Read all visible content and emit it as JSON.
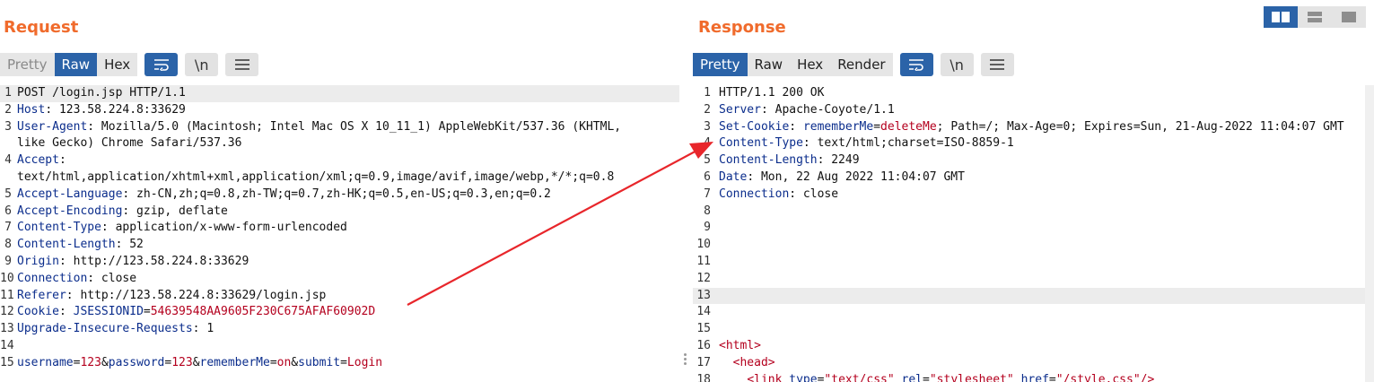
{
  "request": {
    "title": "Request",
    "view_tabs": [
      "Pretty",
      "Raw",
      "Hex"
    ],
    "active_tab": "Raw",
    "icons": [
      "wrap-lines-icon",
      "newline-toggle-icon",
      "menu-icon"
    ],
    "newline_label": "\\n",
    "lines": [
      {
        "n": "1",
        "parts": [
          {
            "t": "POST /login.jsp HTTP/1.1",
            "c": ""
          }
        ]
      },
      {
        "n": "2",
        "parts": [
          {
            "t": "Host",
            "c": "k"
          },
          {
            "t": ": 123.58.224.8:33629",
            "c": ""
          }
        ]
      },
      {
        "n": "3",
        "parts": [
          {
            "t": "User-Agent",
            "c": "k"
          },
          {
            "t": ": Mozilla/5.0 (Macintosh; Intel Mac OS X 10_11_1) AppleWebKit/537.36 (KHTML,",
            "c": ""
          }
        ]
      },
      {
        "n": "",
        "parts": [
          {
            "t": "like Gecko) Chrome Safari/537.36",
            "c": ""
          }
        ]
      },
      {
        "n": "4",
        "parts": [
          {
            "t": "Accept",
            "c": "k"
          },
          {
            "t": ":",
            "c": ""
          }
        ]
      },
      {
        "n": "",
        "parts": [
          {
            "t": "text/html,application/xhtml+xml,application/xml;q=0.9,image/avif,image/webp,*/*;q=0.8",
            "c": ""
          }
        ]
      },
      {
        "n": "5",
        "parts": [
          {
            "t": "Accept-Language",
            "c": "k"
          },
          {
            "t": ": zh-CN,zh;q=0.8,zh-TW;q=0.7,zh-HK;q=0.5,en-US;q=0.3,en;q=0.2",
            "c": ""
          }
        ]
      },
      {
        "n": "6",
        "parts": [
          {
            "t": "Accept-Encoding",
            "c": "k"
          },
          {
            "t": ": gzip, deflate",
            "c": ""
          }
        ]
      },
      {
        "n": "7",
        "parts": [
          {
            "t": "Content-Type",
            "c": "k"
          },
          {
            "t": ": application/x-www-form-urlencoded",
            "c": ""
          }
        ]
      },
      {
        "n": "8",
        "parts": [
          {
            "t": "Content-Length",
            "c": "k"
          },
          {
            "t": ": 52",
            "c": ""
          }
        ]
      },
      {
        "n": "9",
        "parts": [
          {
            "t": "Origin",
            "c": "k"
          },
          {
            "t": ": http://123.58.224.8:33629",
            "c": ""
          }
        ]
      },
      {
        "n": "10",
        "parts": [
          {
            "t": "Connection",
            "c": "k"
          },
          {
            "t": ": close",
            "c": ""
          }
        ]
      },
      {
        "n": "11",
        "parts": [
          {
            "t": "Referer",
            "c": "k"
          },
          {
            "t": ": http://123.58.224.8:33629/login.jsp",
            "c": ""
          }
        ]
      },
      {
        "n": "12",
        "parts": [
          {
            "t": "Cookie",
            "c": "k"
          },
          {
            "t": ": ",
            "c": ""
          },
          {
            "t": "JSESSIONID",
            "c": "k"
          },
          {
            "t": "=",
            "c": ""
          },
          {
            "t": "54639548AA9605F230C675AFAF60902D",
            "c": "v"
          }
        ]
      },
      {
        "n": "13",
        "parts": [
          {
            "t": "Upgrade-Insecure-Requests",
            "c": "k"
          },
          {
            "t": ": 1",
            "c": ""
          }
        ]
      },
      {
        "n": "14",
        "parts": [
          {
            "t": "",
            "c": ""
          }
        ]
      },
      {
        "n": "15",
        "parts": [
          {
            "t": "username",
            "c": "k"
          },
          {
            "t": "=",
            "c": ""
          },
          {
            "t": "123",
            "c": "v"
          },
          {
            "t": "&",
            "c": ""
          },
          {
            "t": "password",
            "c": "k"
          },
          {
            "t": "=",
            "c": ""
          },
          {
            "t": "123",
            "c": "v"
          },
          {
            "t": "&",
            "c": ""
          },
          {
            "t": "rememberMe",
            "c": "k"
          },
          {
            "t": "=",
            "c": ""
          },
          {
            "t": "on",
            "c": "v"
          },
          {
            "t": "&",
            "c": ""
          },
          {
            "t": "submit",
            "c": "k"
          },
          {
            "t": "=",
            "c": ""
          },
          {
            "t": "Login",
            "c": "v"
          }
        ]
      }
    ]
  },
  "response": {
    "title": "Response",
    "view_tabs": [
      "Pretty",
      "Raw",
      "Hex",
      "Render"
    ],
    "active_tab": "Pretty",
    "icons": [
      "wrap-lines-icon",
      "newline-toggle-icon",
      "menu-icon"
    ],
    "newline_label": "\\n",
    "lines": [
      {
        "n": "1",
        "parts": [
          {
            "t": "HTTP/1.1 200 OK",
            "c": ""
          }
        ]
      },
      {
        "n": "2",
        "parts": [
          {
            "t": "Server",
            "c": "k"
          },
          {
            "t": ": Apache-Coyote/1.1",
            "c": ""
          }
        ]
      },
      {
        "n": "3",
        "parts": [
          {
            "t": "Set-Cookie",
            "c": "k"
          },
          {
            "t": ": ",
            "c": ""
          },
          {
            "t": "rememberMe",
            "c": "k"
          },
          {
            "t": "=",
            "c": ""
          },
          {
            "t": "deleteMe",
            "c": "v"
          },
          {
            "t": "; Path=/; Max-Age=0; Expires=Sun, 21-Aug-2022 11:04:07 GMT",
            "c": ""
          }
        ]
      },
      {
        "n": "4",
        "parts": [
          {
            "t": "Content-Type",
            "c": "k"
          },
          {
            "t": ": text/html;charset=ISO-8859-1",
            "c": ""
          }
        ]
      },
      {
        "n": "5",
        "parts": [
          {
            "t": "Content-Length",
            "c": "k"
          },
          {
            "t": ": 2249",
            "c": ""
          }
        ]
      },
      {
        "n": "6",
        "parts": [
          {
            "t": "Date",
            "c": "k"
          },
          {
            "t": ": Mon, 22 Aug 2022 11:04:07 GMT",
            "c": ""
          }
        ]
      },
      {
        "n": "7",
        "parts": [
          {
            "t": "Connection",
            "c": "k"
          },
          {
            "t": ": close",
            "c": ""
          }
        ]
      },
      {
        "n": "8",
        "parts": [
          {
            "t": "",
            "c": ""
          }
        ]
      },
      {
        "n": "9",
        "parts": [
          {
            "t": "",
            "c": ""
          }
        ]
      },
      {
        "n": "10",
        "parts": [
          {
            "t": "",
            "c": ""
          }
        ]
      },
      {
        "n": "11",
        "parts": [
          {
            "t": "",
            "c": ""
          }
        ]
      },
      {
        "n": "12",
        "parts": [
          {
            "t": "",
            "c": ""
          }
        ]
      },
      {
        "n": "13",
        "parts": [
          {
            "t": "",
            "c": ""
          }
        ]
      },
      {
        "n": "14",
        "parts": [
          {
            "t": "",
            "c": ""
          }
        ]
      },
      {
        "n": "15",
        "parts": [
          {
            "t": "",
            "c": ""
          }
        ]
      },
      {
        "n": "16",
        "parts": [
          {
            "t": "<html>",
            "c": "tag"
          }
        ]
      },
      {
        "n": "17",
        "parts": [
          {
            "t": "  ",
            "c": ""
          },
          {
            "t": "<head>",
            "c": "tag"
          }
        ]
      },
      {
        "n": "18",
        "parts": [
          {
            "t": "    ",
            "c": ""
          },
          {
            "t": "<link ",
            "c": "tag"
          },
          {
            "t": "type",
            "c": "k"
          },
          {
            "t": "=",
            "c": ""
          },
          {
            "t": "\"text/css\"",
            "c": "v"
          },
          {
            "t": " ",
            "c": ""
          },
          {
            "t": "rel",
            "c": "k"
          },
          {
            "t": "=",
            "c": ""
          },
          {
            "t": "\"stylesheet\"",
            "c": "v"
          },
          {
            "t": " ",
            "c": ""
          },
          {
            "t": "href",
            "c": "k"
          },
          {
            "t": "=",
            "c": ""
          },
          {
            "t": "\"/style.css\"",
            "c": "v"
          },
          {
            "t": "/>",
            "c": "tag"
          }
        ]
      }
    ]
  },
  "layout_options": [
    "split-horizontal-icon",
    "split-vertical-icon",
    "single-pane-icon"
  ],
  "active_layout": "split-horizontal-icon",
  "colors": {
    "accent": "#f06b2c",
    "active": "#2b63a8",
    "key": "#0b2d8c",
    "value": "#b4001e",
    "arrow": "#e8262b"
  }
}
